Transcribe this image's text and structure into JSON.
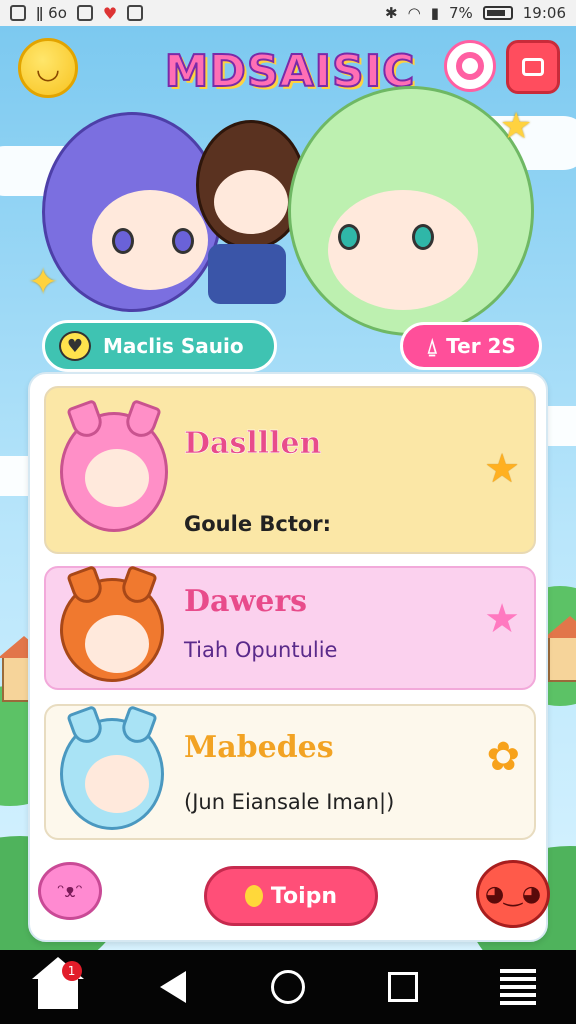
{
  "status_bar": {
    "battery": "7%",
    "time": "19:06"
  },
  "header": {
    "logo_text": "MDSAISIC",
    "smiley_icon": "smiley-icon",
    "target_icon": "target-icon",
    "menu_icon": "window-icon"
  },
  "chips": {
    "left_label": "Maclis Sauio",
    "right_label": "Ter 2S"
  },
  "cards": [
    {
      "title": "Daslllen",
      "subtitle": "Goule Bctor:"
    },
    {
      "title": "Dawers",
      "subtitle": "Tiah Opuntulie"
    },
    {
      "title": "Mabedes",
      "subtitle": "(Jun Eiansale Iman|)"
    }
  ],
  "bottom": {
    "button_label": "Toipn",
    "badge_count": "1"
  },
  "colors": {
    "sky": "#7cc9f0",
    "accent_pink": "#ff4f9a",
    "accent_teal": "#3fc3b2",
    "card_yellow": "#fbe7a6",
    "card_pink": "#fbd1ee",
    "button_red": "#ff4f78"
  }
}
